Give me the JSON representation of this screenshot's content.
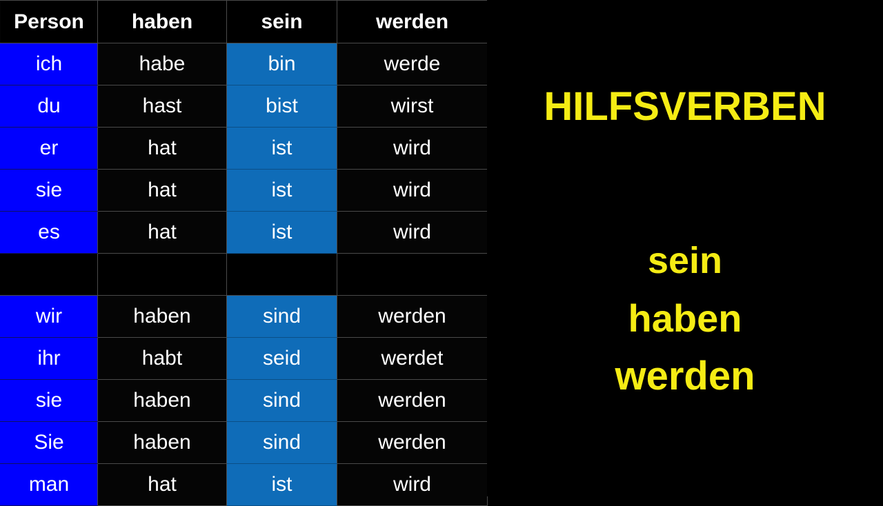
{
  "colors": {
    "background": "#000000",
    "person_cell_blue": "#0000ff",
    "sein_cell_blue": "#0f6cb8",
    "caption_yellow": "#f5ec14",
    "cell_text": "#ffffff",
    "grid_line": "#4a4a4a"
  },
  "table": {
    "headers": [
      "Person",
      "haben",
      "sein",
      "werden"
    ],
    "rows": [
      {
        "type": "data",
        "cells": [
          "ich",
          "habe",
          "bin",
          "werde"
        ]
      },
      {
        "type": "data",
        "cells": [
          "du",
          "hast",
          "bist",
          "wirst"
        ]
      },
      {
        "type": "data",
        "cells": [
          "er",
          "hat",
          "ist",
          "wird"
        ]
      },
      {
        "type": "data",
        "cells": [
          "sie",
          "hat",
          "ist",
          "wird"
        ]
      },
      {
        "type": "data",
        "cells": [
          "es",
          "hat",
          "ist",
          "wird"
        ]
      },
      {
        "type": "spacer",
        "cells": [
          "",
          "",
          "",
          ""
        ]
      },
      {
        "type": "data",
        "cells": [
          "wir",
          "haben",
          "sind",
          "werden"
        ]
      },
      {
        "type": "data",
        "cells": [
          "ihr",
          "habt",
          "seid",
          "werdet"
        ]
      },
      {
        "type": "data",
        "cells": [
          "sie",
          "haben",
          "sind",
          "werden"
        ]
      },
      {
        "type": "data",
        "cells": [
          "Sie",
          "haben",
          "sind",
          "werden"
        ]
      },
      {
        "type": "data",
        "cells": [
          "man",
          "hat",
          "ist",
          "wird"
        ]
      }
    ]
  },
  "caption": {
    "title": "HILFSVERBEN",
    "verbs": [
      "sein",
      "haben",
      "werden"
    ]
  }
}
